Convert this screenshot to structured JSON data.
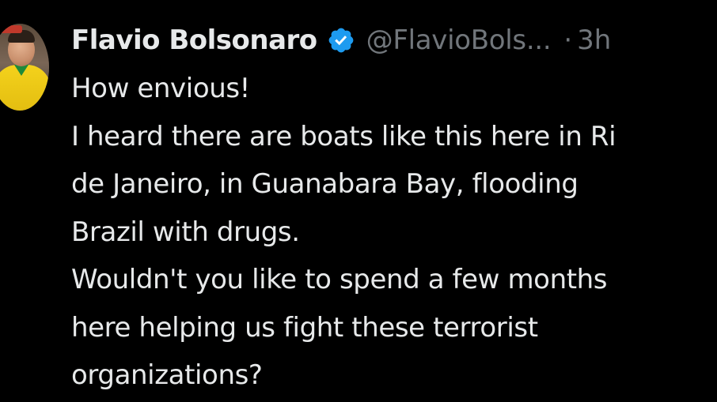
{
  "tweet": {
    "author_name": "Flavio Bolsonaro",
    "verified": true,
    "verified_color": "#1d9bf0",
    "handle": "@FlavioBols...",
    "separator": "·",
    "time": "3h",
    "lines": [
      "How envious!",
      "I heard there are boats like this here in Ri",
      "de Janeiro, in Guanabara Bay, flooding",
      "Brazil with drugs.",
      "Wouldn't you like to spend a few months",
      "here helping us fight these terrorist",
      "organizations?"
    ]
  },
  "icons": {
    "verified_badge": "verified-badge-icon"
  },
  "colors": {
    "background": "#000000",
    "text_primary": "#e7e9ea",
    "text_secondary": "#71767b"
  }
}
